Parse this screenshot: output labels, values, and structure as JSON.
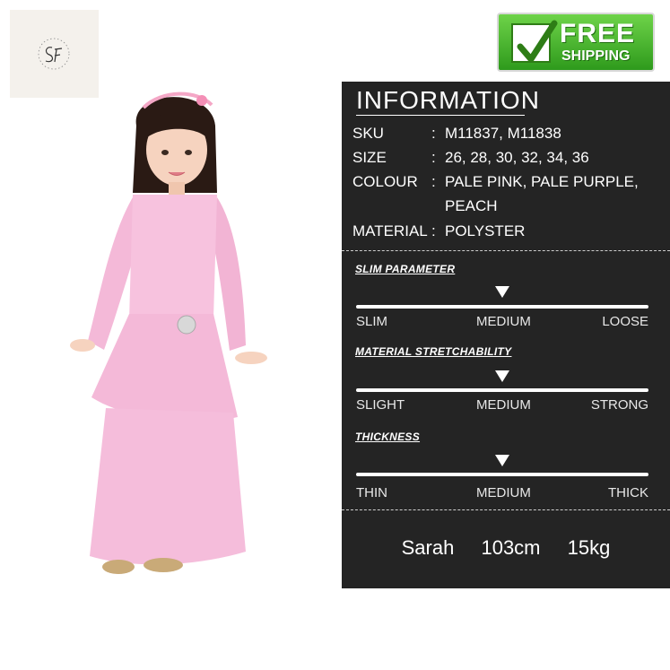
{
  "logo": {
    "text": "SF",
    "icon": "brand-logo"
  },
  "badge": {
    "line1": "FREE",
    "line2": "SHIPPING",
    "icon": "checkmark-icon"
  },
  "info": {
    "title": "INFORMATION",
    "specs": [
      {
        "key": "SKU",
        "sep": ":",
        "value": "M11837, M11838"
      },
      {
        "key": "SIZE",
        "sep": ":",
        "value": "26, 28, 30, 32, 34, 36"
      },
      {
        "key": "COLOUR",
        "sep": ":",
        "value": "PALE PINK, PALE PURPLE, PEACH"
      },
      {
        "key": "MATERIAL",
        "sep": ":",
        "value": "POLYSTER"
      }
    ]
  },
  "parameters": [
    {
      "title": "SLIM PARAMETER",
      "labels": [
        "SLIM",
        "MEDIUM",
        "LOOSE"
      ],
      "selected": "MEDIUM"
    },
    {
      "title": "MATERIAL STRETCHABILITY",
      "labels": [
        "SLIGHT",
        "MEDIUM",
        "STRONG"
      ],
      "selected": "MEDIUM"
    },
    {
      "title": "THICKNESS",
      "labels": [
        "THIN",
        "MEDIUM",
        "THICK"
      ],
      "selected": "MEDIUM"
    }
  ],
  "model": {
    "name": "Sarah",
    "height": "103cm",
    "weight": "15kg"
  },
  "colors": {
    "panel": "#242424",
    "dress": "#f4b9d8",
    "badge_green": "#3fae27"
  }
}
